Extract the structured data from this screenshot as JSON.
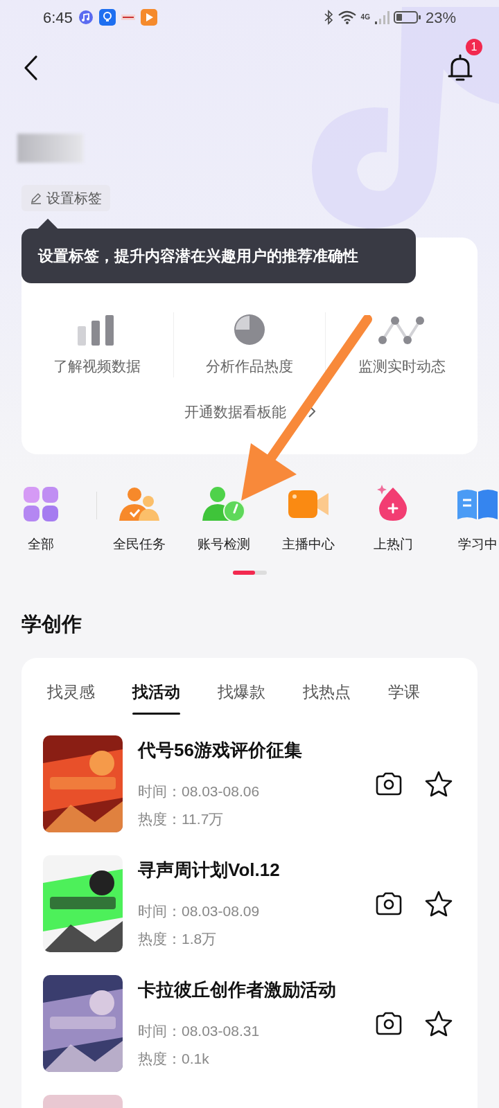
{
  "status_bar": {
    "time": "6:45",
    "network": "4G",
    "battery": "23%"
  },
  "header": {
    "notification_badge": "1"
  },
  "profile": {
    "tag_button": "设置标签",
    "tooltip": "设置标签，提升内容潜在兴趣用户的推荐准确性"
  },
  "data_card": {
    "features": [
      {
        "label": "了解视频数据",
        "kind": "bars"
      },
      {
        "label": "分析作品热度",
        "kind": "pie"
      },
      {
        "label": "监测实时动态",
        "kind": "line"
      }
    ],
    "link": "开通数据看板能"
  },
  "shortcuts": [
    {
      "label": "全部",
      "kind": "grid"
    },
    {
      "label": "全民任务",
      "kind": "people"
    },
    {
      "label": "账号检测",
      "kind": "account"
    },
    {
      "label": "主播中心",
      "kind": "camera"
    },
    {
      "label": "上热门",
      "kind": "fire"
    },
    {
      "label": "学习中",
      "kind": "book"
    }
  ],
  "section_title": "学创作",
  "tabs": [
    {
      "label": "找灵感",
      "selected": false
    },
    {
      "label": "找活动",
      "selected": true
    },
    {
      "label": "找爆款",
      "selected": false
    },
    {
      "label": "找热点",
      "selected": false
    },
    {
      "label": "学课",
      "selected": false
    }
  ],
  "activities": [
    {
      "kind": "activity",
      "title": "代号56游戏评价征集",
      "time": "时间：08.03-08.06",
      "heat": "热度：11.7万"
    },
    {
      "kind": "activity",
      "title": "寻声周计划Vol.12",
      "time": "时间：08.03-08.09",
      "heat": "热度：1.8万"
    },
    {
      "kind": "activity",
      "title": "卡拉彼丘创作者激励活动",
      "time": "时间：08.03-08.31",
      "heat": "热度：0.1k"
    },
    {
      "kind": "picture"
    }
  ]
}
